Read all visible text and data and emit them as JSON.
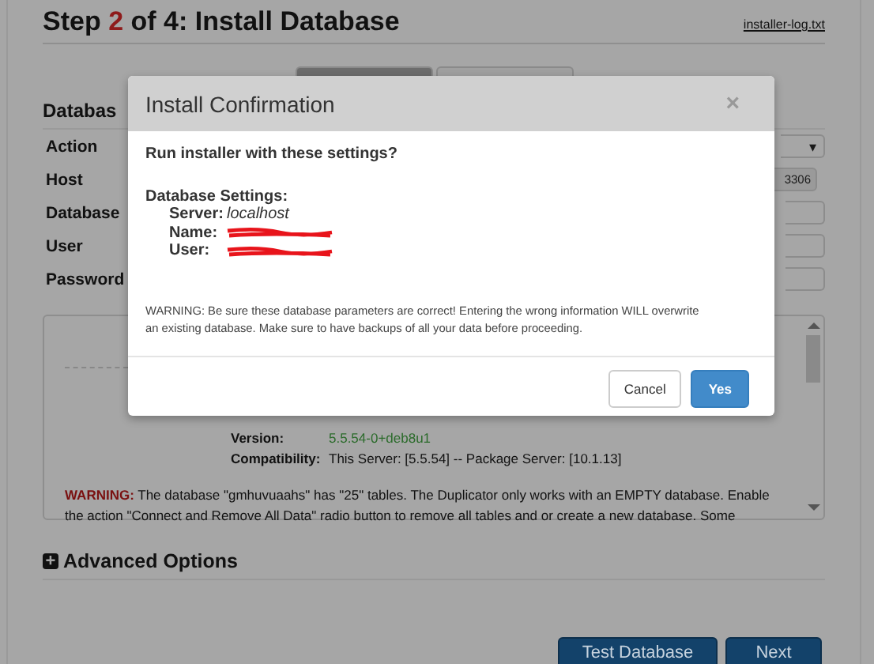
{
  "page": {
    "title": {
      "before": "Step ",
      "number": "2",
      "after": " of 4: Install Database"
    },
    "log_link": "installer-log.txt",
    "tabs": [
      {
        "selected": true
      },
      {
        "selected": false
      }
    ],
    "section_heading": "Databas",
    "fields": [
      {
        "label": "Action",
        "kind": "select",
        "caret": "▾"
      },
      {
        "label": "Host",
        "kind": "input",
        "value": "3306"
      },
      {
        "label": "Database",
        "kind": "input"
      },
      {
        "label": "User",
        "kind": "input"
      },
      {
        "label": "Password",
        "kind": "input"
      }
    ],
    "details": {
      "rows": [
        {
          "label": "Version:",
          "value": "5.5.54-0+deb8u1",
          "kind": "good"
        },
        {
          "label": "Compatibility:",
          "value": "This Server: [5.5.54] -- Package Server: [10.1.13]",
          "kind": "plain"
        }
      ],
      "warning_label": "WARNING:",
      "warning_lines": [
        " The database \"gmhuvuaahs\" has \"25\" tables. The Duplicator only works with an EMPTY database. Enable",
        "the action \"Connect and Remove All Data\" radio button to remove all tables and or create a new database. Some"
      ]
    },
    "advanced": {
      "icon": "+",
      "label": "Advanced Options"
    },
    "buttons": [
      "Test Database",
      "Next"
    ]
  },
  "modal": {
    "title": "Install Confirmation",
    "close": "×",
    "question": "Run installer with these settings?",
    "settings_heading": "Database Settings:",
    "settings": [
      {
        "label": "Server:",
        "value": "localhost",
        "redacted": false
      },
      {
        "label": "Name:",
        "redacted": true
      },
      {
        "label": "User:",
        "redacted": true
      }
    ],
    "warning": "WARNING: Be sure these database parameters are correct! Entering the wrong information WILL overwrite an existing database. Make sure to have backups of all your data before proceeding.",
    "buttons": [
      {
        "label": "Cancel",
        "kind": "default"
      },
      {
        "label": "Yes",
        "kind": "primary"
      }
    ]
  }
}
